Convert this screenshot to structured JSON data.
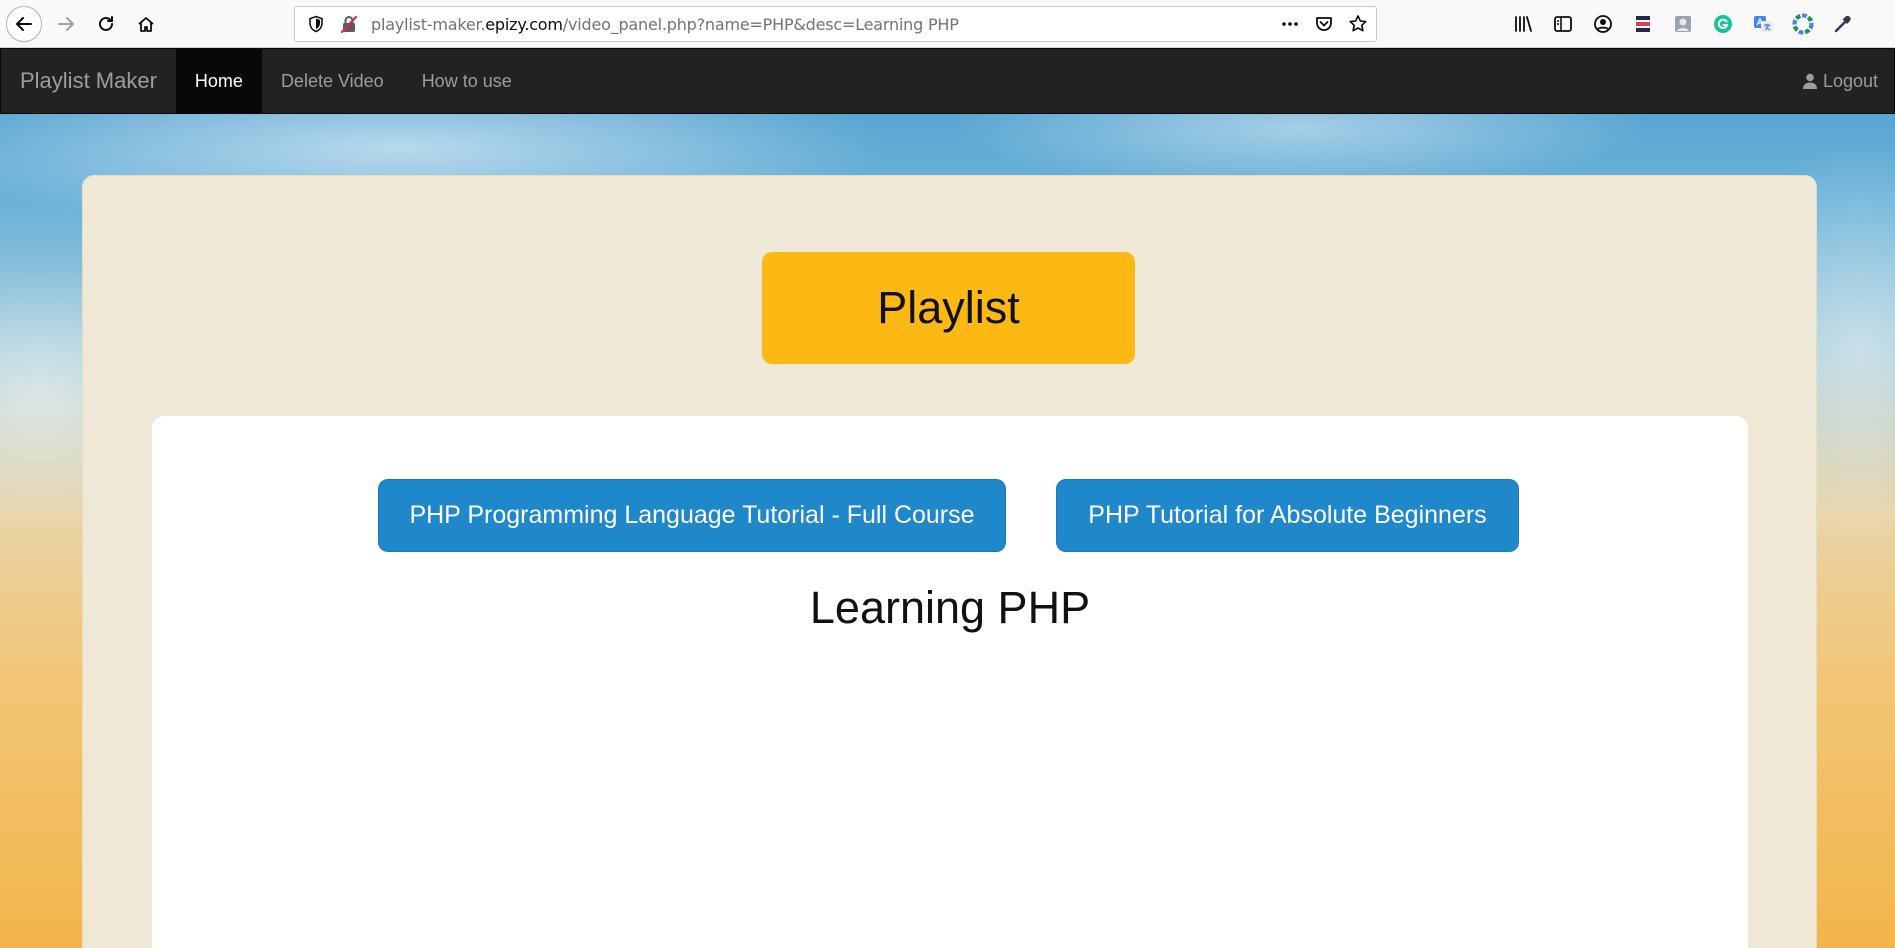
{
  "browser": {
    "url_prefix": "playlist-maker.",
    "url_domain": "epizy.com",
    "url_path": "/video_panel.php?name=PHP&desc=Learning PHP",
    "icons": [
      "back-icon",
      "forward-icon",
      "reload-icon",
      "home-icon",
      "shield-icon",
      "insecure-lock-icon",
      "more-icon",
      "pocket-icon",
      "bookmark-star-icon",
      "library-icon",
      "sidebar-icon",
      "account-icon",
      "extension-stack-icon",
      "extension-profile-icon",
      "grammarly-icon",
      "translate-icon",
      "color-wheel-icon",
      "eyedropper-icon"
    ]
  },
  "navbar": {
    "brand": "Playlist Maker",
    "links": [
      {
        "label": "Home",
        "active": true
      },
      {
        "label": "Delete Video",
        "active": false
      },
      {
        "label": "How to use",
        "active": false
      }
    ],
    "logout": "Logout"
  },
  "panel": {
    "title": "Playlist",
    "videos": [
      {
        "label": "PHP Programming Language Tutorial - Full Course"
      },
      {
        "label": "PHP Tutorial for Absolute Beginners"
      }
    ],
    "description": "Learning PHP"
  },
  "colors": {
    "navbar_bg": "#222222",
    "title_bg": "#fdb913",
    "button_bg": "#1f88ca",
    "panel_bg": "#f0e8d6"
  }
}
